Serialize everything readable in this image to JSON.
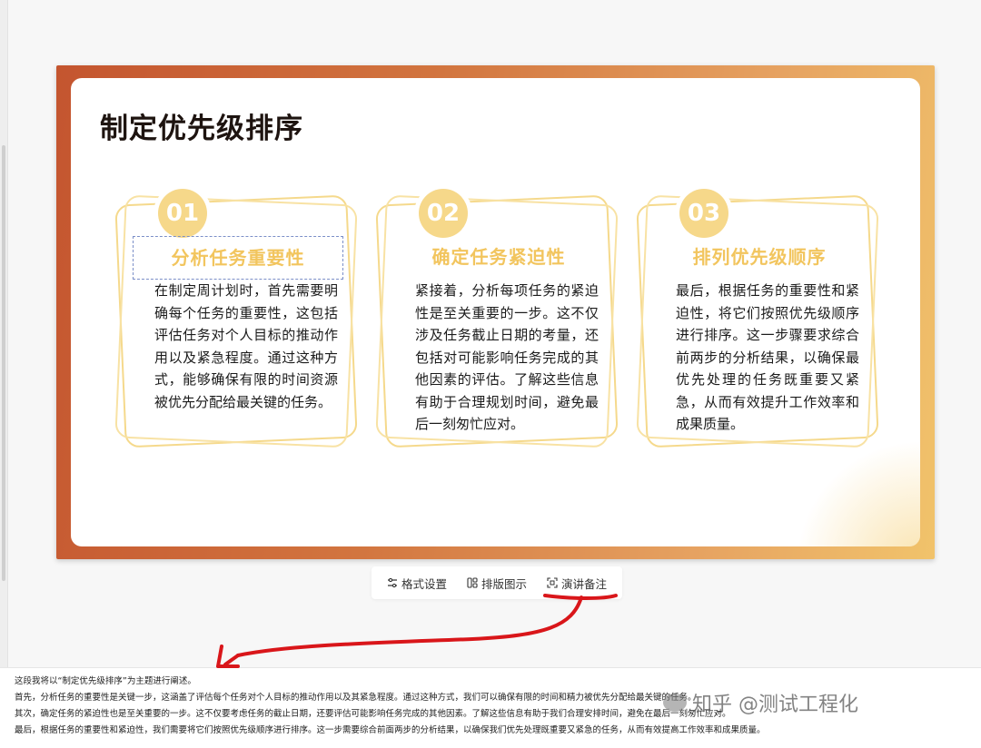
{
  "slide": {
    "title": "制定优先级排序",
    "cards": [
      {
        "num": "01",
        "title": "分析任务重要性",
        "body": "在制定周计划时，首先需要明确每个任务的重要性，这包括评估任务对个人目标的推动作用以及紧急程度。通过这种方式，能够确保有限的时间资源被优先分配给最关键的任务。"
      },
      {
        "num": "02",
        "title": "确定任务紧迫性",
        "body": "紧接着，分析每项任务的紧迫性是至关重要的一步。这不仅涉及任务截止日期的考量，还包括对可能影响任务完成的其他因素的评估。了解这些信息有助于合理规划时间，避免最后一刻匆忙应对。"
      },
      {
        "num": "03",
        "title": "排列优先级顺序",
        "body": "最后，根据任务的重要性和紧迫性，将它们按照优先级顺序进行排序。这一步骤要求综合前两步的分析结果，以确保最优先处理的任务既重要又紧急，从而有效提升工作效率和成果质量。"
      }
    ]
  },
  "toolbar": {
    "format": "格式设置",
    "layout": "排版图示",
    "notes": "演讲备注"
  },
  "notes": {
    "lines": [
      "这段我将以“制定优先级排序”为主题进行阐述。",
      "首先，分析任务的重要性是关键一步，这涵盖了评估每个任务对个人目标的推动作用以及其紧急程度。通过这种方式，我们可以确保有限的时间和精力被优先分配给最关键的任务。",
      "其次，确定任务的紧迫性也是至关重要的一步。这不仅要考虑任务的截止日期，还要评估可能影响任务完成的其他因素。了解这些信息有助于我们合理安排时间，避免在最后一刻匆忙应对。",
      "最后，根据任务的重要性和紧迫性，我们需要将它们按照优先级顺序进行排序。这一步需要综合前面两步的分析结果，以确保我们优先处理既重要又紧急的任务，从而有效提高工作效率和成果质量。"
    ]
  },
  "watermark": "知乎 @测试工程化",
  "colors": {
    "frame_start": "#c4552f",
    "frame_end": "#f1c36b",
    "card_accent": "#f6d88a",
    "card_title": "#f2c55e",
    "annotation_red": "#d9161a"
  }
}
